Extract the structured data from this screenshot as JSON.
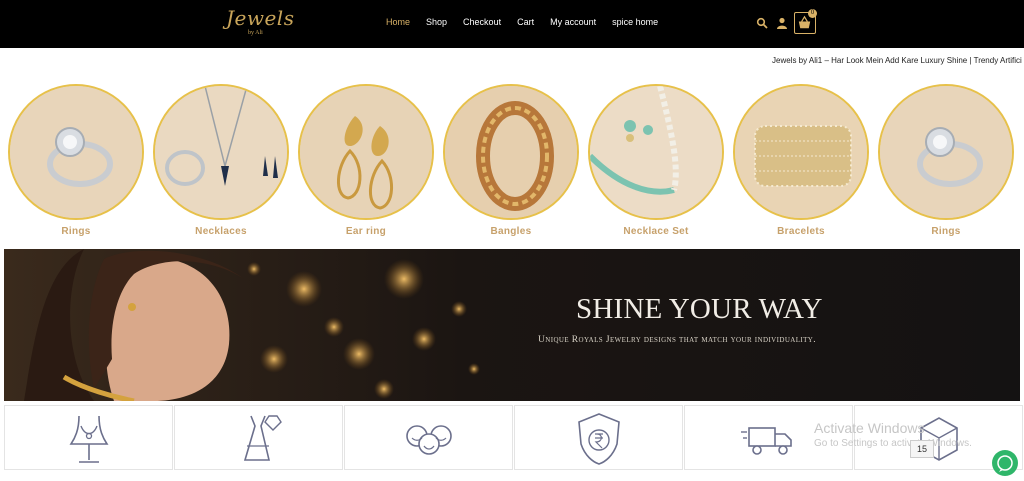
{
  "header": {
    "logo_text": "Jewels",
    "logo_sub": "by Ali",
    "nav": [
      {
        "label": "Home",
        "active": true
      },
      {
        "label": "Shop",
        "active": false
      },
      {
        "label": "Checkout",
        "active": false
      },
      {
        "label": "Cart",
        "active": false
      },
      {
        "label": "My account",
        "active": false
      },
      {
        "label": "spice home",
        "active": false
      }
    ],
    "icons": [
      "search-icon",
      "user-icon",
      "cart-icon"
    ],
    "cart_count": "0",
    "accent": "#d9b267",
    "background": "#000000"
  },
  "marquee": {
    "text": "Jewels by Ali1 – Har Look Mein Add Kare Luxury Shine | Trendy Artifici"
  },
  "categories": [
    {
      "label": "Rings"
    },
    {
      "label": "Necklaces"
    },
    {
      "label": "Ear ring"
    },
    {
      "label": "Bangles"
    },
    {
      "label": "Necklace Set"
    },
    {
      "label": "Bracelets"
    },
    {
      "label": "Rings"
    }
  ],
  "banner": {
    "title": "SHINE YOUR WAY",
    "subtitle": "Unique Royals Jewelry designs that match your individuality."
  },
  "features": [
    {
      "icon": "necklace-bust-icon"
    },
    {
      "icon": "dress-diamond-icon"
    },
    {
      "icon": "happy-faces-icon"
    },
    {
      "icon": "rupee-shield-icon"
    },
    {
      "icon": "delivery-truck-icon"
    },
    {
      "icon": "box-return-icon"
    }
  ],
  "os_overlay": {
    "title": "Activate Windows",
    "subtitle": "Go to Settings to activate Windows.",
    "badge": "15"
  }
}
